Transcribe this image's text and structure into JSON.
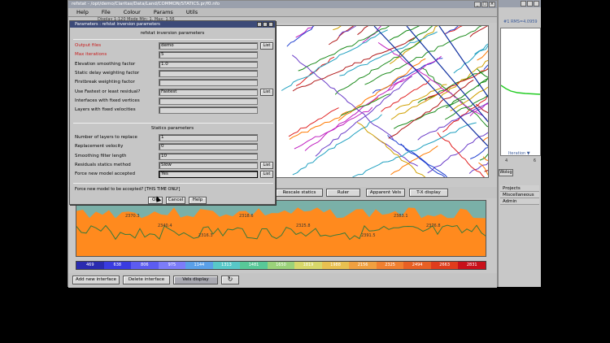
{
  "main_window": {
    "title": "refstat - /opt/demo/Claritas/Data/Land/COMMON/STATICS.pr/f0.nfo",
    "menu": [
      "Help",
      "File",
      "Colour",
      "Params",
      "Utils"
    ],
    "info_line": "Display   1-120   Mode   Min: 1, Max: 1.56"
  },
  "toolbar": {
    "buttons": [
      "Rescale statics",
      "Ruler",
      "Apparent Vels",
      "T-X display"
    ]
  },
  "colorbar": {
    "values": [
      "469",
      "638",
      "806",
      "975",
      "1144",
      "1313",
      "1481",
      "1650",
      "1819",
      "1988",
      "2156",
      "2325",
      "2494",
      "2663",
      "2831"
    ],
    "colors": [
      "#2a2bb0",
      "#3a3ce0",
      "#5c5cf0",
      "#7c7cf8",
      "#5aa0e8",
      "#58c8c8",
      "#58c898",
      "#9ad27a",
      "#d8d86a",
      "#e8c050",
      "#f0a040",
      "#f08030",
      "#e86024",
      "#e03c1c",
      "#c8101a"
    ]
  },
  "bottom_bar": {
    "buttons": [
      "Add new interface",
      "Delete interface",
      "Vels display"
    ]
  },
  "side_window": {
    "readout": "#1 RMS=4.0959",
    "plot_label": "Iteration ▼",
    "ticks": [
      "4",
      "6"
    ],
    "tab": "Wolog",
    "menu": [
      "Projects",
      "Miscellaneous",
      "Admin"
    ]
  },
  "dialog": {
    "title": "Parameters : refstat inversion parameters",
    "heading": "refstat inversion parameters",
    "statics_heading": "Statics parameters",
    "list_label": "List",
    "fields": [
      {
        "label": "Output files",
        "value": "demo",
        "red": true,
        "list": true
      },
      {
        "label": "Max iterations",
        "value": "5",
        "red": true,
        "list": false
      },
      {
        "label": "Elevation smoothing factor",
        "value": "1.0",
        "red": false,
        "list": false
      },
      {
        "label": "Static delay weighting factor",
        "value": "",
        "red": false,
        "list": false
      },
      {
        "label": "Firstbreak weighting factor",
        "value": "",
        "red": false,
        "list": false
      },
      {
        "label": "Use Fastest or least residual?",
        "value": "Fastest",
        "red": false,
        "list": true
      },
      {
        "label": "Interfaces with fixed vertices",
        "value": "",
        "red": false,
        "list": false
      },
      {
        "label": "Layers with fixed velocities",
        "value": "",
        "red": false,
        "list": false
      }
    ],
    "statics_fields": [
      {
        "label": "Number of layers to replace",
        "value": "1",
        "list": false
      },
      {
        "label": "Replacement velocity",
        "value": "0",
        "list": false
      },
      {
        "label": "Smoothing filter length",
        "value": "10",
        "list": false
      },
      {
        "label": "Residuals statics method",
        "value": "Slow",
        "list": true
      },
      {
        "label": "Force new model accepted",
        "value": "Yes",
        "list": true
      }
    ],
    "prompt": "Force new model to be accepted? [THIS TIME ONLY]",
    "buttons": [
      "OK",
      "Cancel",
      "Help"
    ]
  },
  "statics_annotations": [
    "2370.3",
    "2340.4",
    "2316.3",
    "2318.6",
    "2325.8",
    "2391.5",
    "2383.1",
    "2376.8"
  ]
}
